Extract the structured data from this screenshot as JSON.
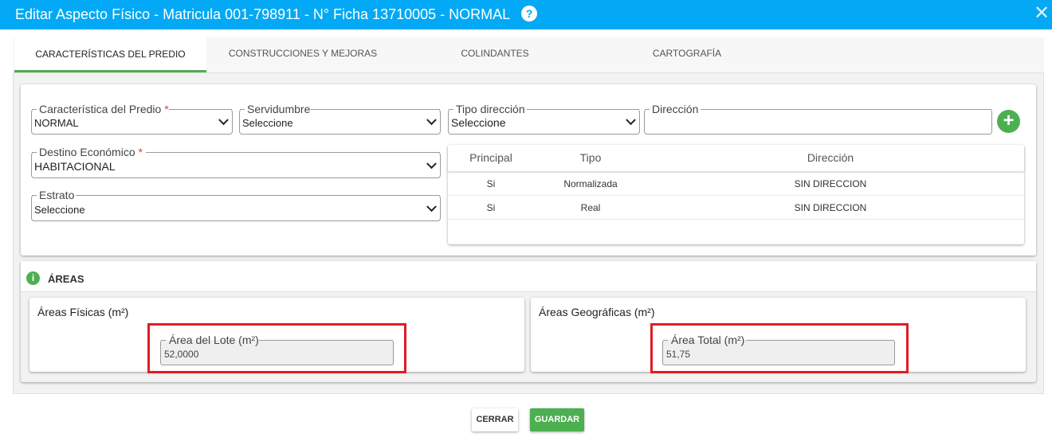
{
  "header": {
    "title": "Editar Aspecto Físico - Matricula 001-798911 - N° Ficha 13710005 - NORMAL",
    "help_icon": "?",
    "close_icon": "✕"
  },
  "tabs": [
    {
      "label": "CARACTERÍSTICAS DEL PREDIO",
      "active": true
    },
    {
      "label": "CONSTRUCCIONES Y MEJORAS",
      "active": false
    },
    {
      "label": "COLINDANTES",
      "active": false
    },
    {
      "label": "CARTOGRAFÍA",
      "active": false
    }
  ],
  "form": {
    "caracteristica": {
      "label": "Característica del Predio",
      "required": "*",
      "value": "NORMAL"
    },
    "servidumbre": {
      "label": "Servidumbre",
      "value": "Seleccione"
    },
    "tipo_direccion": {
      "label": "Tipo dirección",
      "value": "Seleccione"
    },
    "direccion": {
      "label": "Dirección",
      "value": ""
    },
    "destino": {
      "label": "Destino Económico",
      "required": "*",
      "value": "HABITACIONAL"
    },
    "estrato": {
      "label": "Estrato",
      "value": "Seleccione"
    },
    "add_icon": "+"
  },
  "address_table": {
    "columns": [
      "Principal",
      "Tipo",
      "Dirección"
    ],
    "rows": [
      [
        "Si",
        "Normalizada",
        "SIN DIRECCION"
      ],
      [
        "Si",
        "Real",
        "SIN DIRECCION"
      ]
    ]
  },
  "areas": {
    "info_icon": "i",
    "title": "ÁREAS",
    "fisicas": {
      "title": "Áreas Físicas (m²)",
      "field_label": "Área del Lote (m²)",
      "field_value": "52,0000"
    },
    "geograficas": {
      "title": "Áreas Geográficas (m²)",
      "field_label": "Área Total (m²)",
      "field_value": "51,75"
    }
  },
  "footer": {
    "close_label": "CERRAR",
    "save_label": "GUARDAR"
  },
  "colors": {
    "header_bg": "#03a9f4",
    "accent_green": "#4caf50",
    "highlight_red": "#e21b24"
  }
}
